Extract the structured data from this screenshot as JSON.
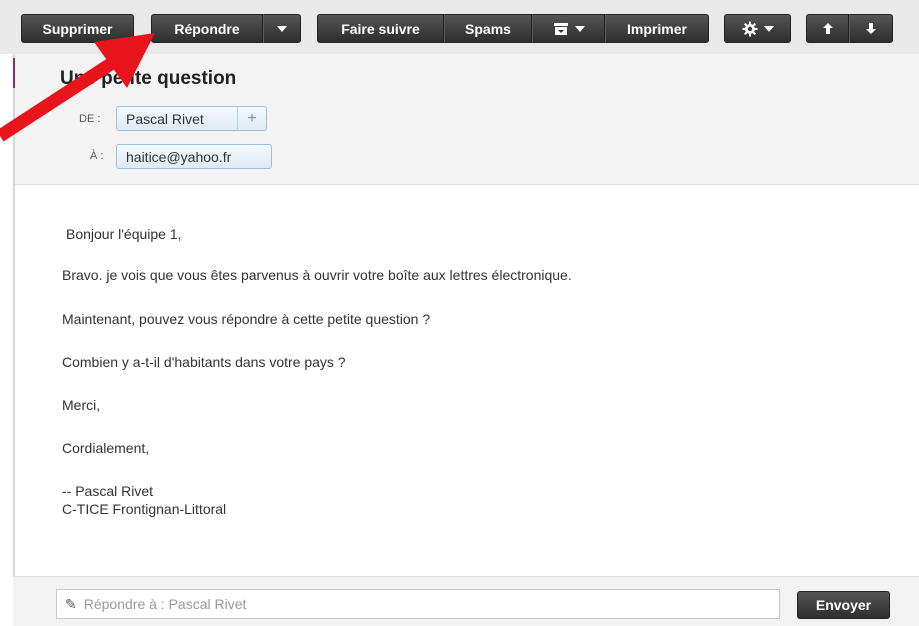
{
  "toolbar": {
    "delete": "Supprimer",
    "reply": "Répondre",
    "forward": "Faire suivre",
    "spam": "Spams",
    "print": "Imprimer"
  },
  "message": {
    "subject": "Une petite question",
    "from_label": "DE :",
    "from": "Pascal Rivet",
    "from_add": "+",
    "to_label": "À :",
    "to": "haitice@yahoo.fr",
    "body": [
      "Bonjour l'équipe 1,",
      "Bravo. je vois que vous êtes parvenus à ouvrir votre boîte aux lettres électronique.",
      "Maintenant, pouvez vous répondre à cette petite question ?",
      "Combien y a-t-il d'habitants dans votre pays ?",
      "Merci,",
      "Cordialement,",
      "-- Pascal Rivet",
      "C-TICE Frontignan-Littoral"
    ]
  },
  "reply": {
    "placeholder": "Répondre à : Pascal Rivet",
    "send": "Envoyer"
  },
  "icons": {
    "archive": "archive-icon",
    "settings": "gear-icon",
    "up": "arrow-up-icon",
    "down": "arrow-down-icon",
    "pencil": "pencil-icon"
  },
  "colors": {
    "toolbar_button": "#3a3a3a",
    "chip_border": "#9fc0dc",
    "annotation_arrow": "#e8141c"
  }
}
